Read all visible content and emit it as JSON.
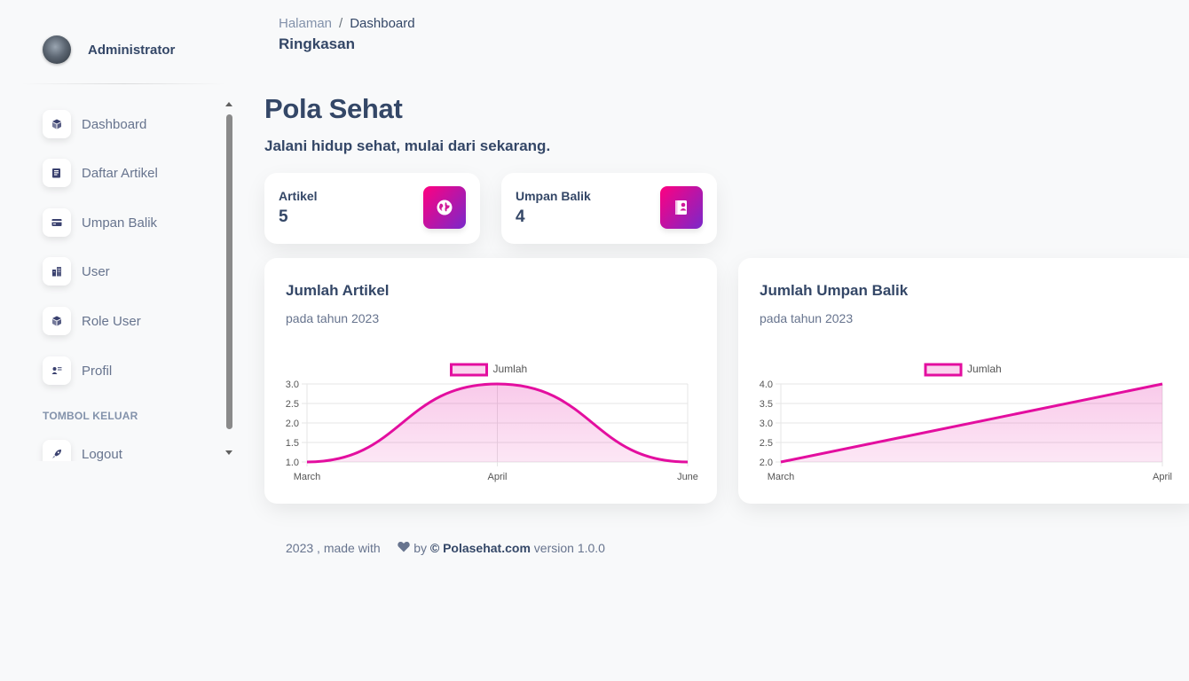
{
  "sidebar": {
    "user_name": "Administrator",
    "items": [
      {
        "label": "Dashboard",
        "icon": "shop-icon"
      },
      {
        "label": "Daftar Artikel",
        "icon": "document-icon"
      },
      {
        "label": "Umpan Balik",
        "icon": "credit-card-icon"
      },
      {
        "label": "User",
        "icon": "building-icon"
      },
      {
        "label": "Role User",
        "icon": "box-icon"
      },
      {
        "label": "Profil",
        "icon": "user-badge-icon"
      }
    ],
    "section_label": "TOMBOL KELUAR",
    "logout_label": "Logout"
  },
  "header": {
    "breadcrumb_parent": "Halaman",
    "breadcrumb_sep": "/",
    "breadcrumb_current": "Dashboard",
    "page_title": "Ringkasan"
  },
  "hero": {
    "title": "Pola Sehat",
    "subtitle": "Jalani hidup sehat, mulai dari sekarang."
  },
  "stats": [
    {
      "label": "Artikel",
      "value": "5",
      "icon": "globe-icon"
    },
    {
      "label": "Umpan Balik",
      "value": "4",
      "icon": "feedback-icon"
    }
  ],
  "charts": [
    {
      "title": "Jumlah Artikel",
      "subtitle": "pada tahun 2023"
    },
    {
      "title": "Jumlah Umpan Balik",
      "subtitle": "pada tahun 2023"
    }
  ],
  "chart_data": [
    {
      "type": "area",
      "title": "Jumlah Artikel",
      "categories": [
        "March",
        "April",
        "June"
      ],
      "series": [
        {
          "name": "Jumlah",
          "values": [
            1,
            3,
            1
          ]
        }
      ],
      "ylim": [
        1.0,
        3.0
      ],
      "yticks": [
        "3.0",
        "2.5",
        "2.0",
        "1.5",
        "1.0"
      ],
      "legend": "top-center",
      "grid": true
    },
    {
      "type": "area",
      "title": "Jumlah Umpan Balik",
      "categories": [
        "March",
        "April"
      ],
      "series": [
        {
          "name": "Jumlah",
          "values": [
            2,
            4
          ]
        }
      ],
      "ylim": [
        2.0,
        4.0
      ],
      "yticks": [
        "4.0",
        "3.5",
        "3.0",
        "2.5",
        "2.0"
      ],
      "legend": "top-center",
      "grid": true
    }
  ],
  "footer": {
    "year_text": "2023 , made with",
    "by_text": "by",
    "brand": "© Polasehat.com",
    "version_text": "version 1.0.0"
  },
  "colors": {
    "accent": "#e30e9f",
    "accent_gradient_start": "#7928ca",
    "accent_gradient_end": "#ff0080",
    "text_dark": "#344767",
    "text_muted": "#67748e"
  }
}
